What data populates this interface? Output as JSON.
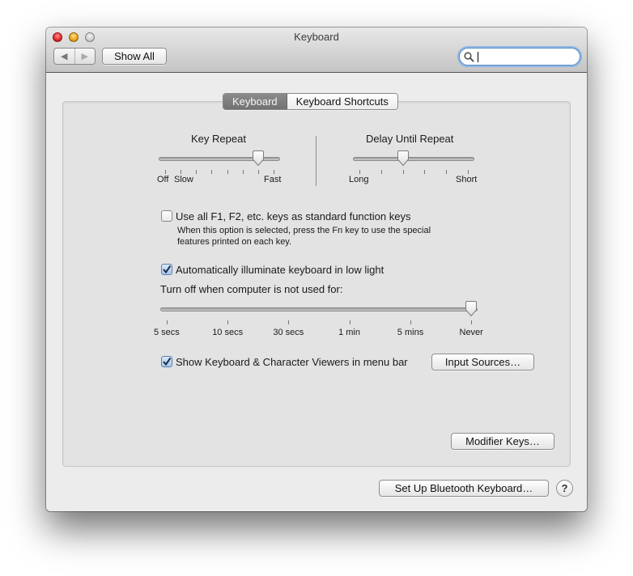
{
  "window": {
    "title": "Keyboard",
    "traffic_lights": [
      "close",
      "minimize",
      "zoom"
    ]
  },
  "toolbar": {
    "back_icon": "left-triangle-icon",
    "forward_icon": "right-triangle-icon",
    "show_all_label": "Show All",
    "search": {
      "value": "",
      "placeholder": "",
      "icon": "magnifier-icon"
    }
  },
  "tabs": [
    {
      "label": "Keyboard",
      "active": true
    },
    {
      "label": "Keyboard Shortcuts",
      "active": false
    }
  ],
  "key_repeat": {
    "title": "Key Repeat",
    "tick_count": 8,
    "value_index": 6,
    "labels": {
      "off": "Off",
      "slow": "Slow",
      "fast": "Fast"
    }
  },
  "delay_until_repeat": {
    "title": "Delay Until Repeat",
    "tick_count": 6,
    "value_index": 2,
    "labels": {
      "long": "Long",
      "short": "Short"
    }
  },
  "function_keys": {
    "checked": false,
    "label": "Use all F1, F2, etc. keys as standard function keys",
    "description_line1": "When this option is selected, press the Fn key to use the special",
    "description_line2": "features printed on each key."
  },
  "illuminate": {
    "checked": true,
    "label": "Automatically illuminate keyboard in low light",
    "turn_off_label": "Turn off when computer is not used for:",
    "options": [
      "5 secs",
      "10 secs",
      "30 secs",
      "1 min",
      "5 mins",
      "Never"
    ],
    "value_index": 5
  },
  "viewers": {
    "checked": true,
    "label": "Show Keyboard & Character Viewers in menu bar",
    "input_sources_label": "Input Sources…"
  },
  "modifier_keys_label": "Modifier Keys…",
  "bluetooth_label": "Set Up Bluetooth Keyboard…",
  "help_label": "?"
}
